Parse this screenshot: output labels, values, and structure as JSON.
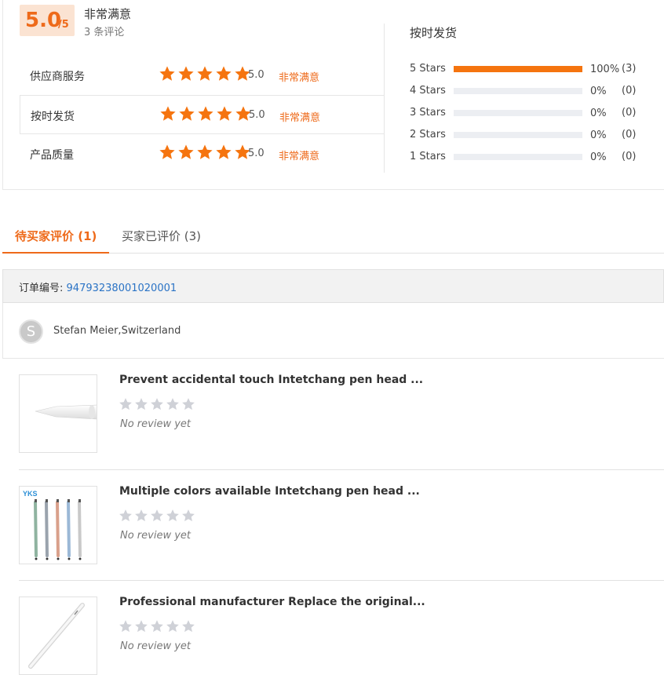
{
  "summary": {
    "score": "5.0",
    "score_max": "/5",
    "overall_label": "非常满意",
    "review_count": "3 条评论",
    "accent_color": "#ee6a1a",
    "metrics": [
      {
        "label": "供应商服务",
        "stars": 5,
        "score": "5.0",
        "text": "非常满意"
      },
      {
        "label": "按时发货",
        "stars": 5,
        "score": "5.0",
        "text": "非常满意"
      },
      {
        "label": "产品质量",
        "stars": 5,
        "score": "5.0",
        "text": "非常满意"
      }
    ],
    "distribution_title": "按时发货",
    "distribution": [
      {
        "label": "5  Stars",
        "fraction": 1.0,
        "pct": "100%",
        "count": "(3)"
      },
      {
        "label": "4  Stars",
        "fraction": 0.0,
        "pct": "0%",
        "count": "(0)"
      },
      {
        "label": "3  Stars",
        "fraction": 0.0,
        "pct": "0%",
        "count": "(0)"
      },
      {
        "label": "2  Stars",
        "fraction": 0.0,
        "pct": "0%",
        "count": "(0)"
      },
      {
        "label": "1  Stars",
        "fraction": 0.0,
        "pct": "0%",
        "count": "(0)"
      }
    ]
  },
  "tabs": [
    {
      "label": "待买家评价 (1)",
      "active": true
    },
    {
      "label": "买家已评价 (3)",
      "active": false
    }
  ],
  "order": {
    "label": "订单编号:",
    "number": "94793238001020001",
    "buyer_initial": "S",
    "buyer_name": "Stefan Meier,Switzerland"
  },
  "products": [
    {
      "title": "Prevent accidental touch Intetchang pen head ...",
      "stars": 0,
      "status": "No review yet",
      "thumb_icon": "stylus-tip-icon"
    },
    {
      "title": "Multiple colors available Intetchang pen head ...",
      "stars": 0,
      "status": "No review yet",
      "thumb_icon": "colored-pens-icon",
      "thumb_brand": "YKS"
    },
    {
      "title": "Professional manufacturer Replace the original...",
      "stars": 0,
      "status": "No review yet",
      "thumb_icon": "white-stylus-icon"
    }
  ],
  "colors": {
    "star_filled": "#f5740f",
    "star_empty": "#cfd1d7",
    "link_blue": "#2a73c5"
  }
}
